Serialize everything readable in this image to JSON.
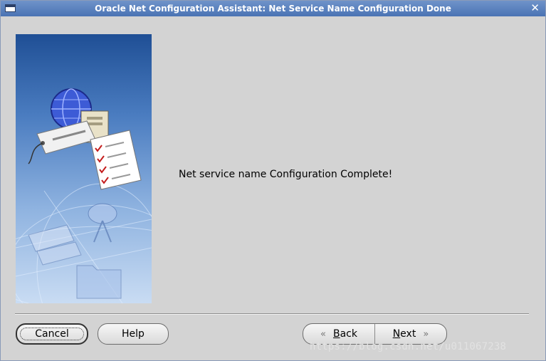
{
  "window": {
    "title": "Oracle Net Configuration Assistant: Net Service Name Configuration Done",
    "close_glyph": "✕"
  },
  "content": {
    "message": "Net service name Configuration Complete!"
  },
  "buttons": {
    "cancel": "Cancel",
    "help": "Help",
    "back_rest": "ack",
    "back_mnemonic": "B",
    "next_mnemonic": "N",
    "next_rest": "ext"
  },
  "watermark": "https://blog.csdn.net/u011067238",
  "icons": {
    "system_menu": "system-menu-icon",
    "close": "close-icon",
    "back": "chevron-left-icon",
    "next": "chevron-right-icon"
  },
  "colors": {
    "titlebar": "#5a80bd",
    "dialog_bg": "#d3d3d3",
    "panel_top": "#1f4f95",
    "panel_bottom": "#c9dcf3"
  }
}
